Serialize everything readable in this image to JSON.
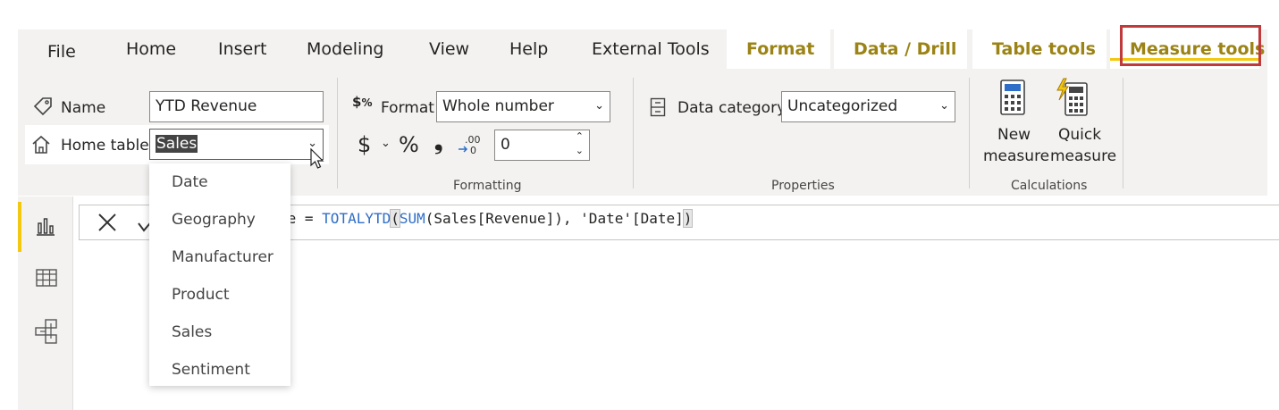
{
  "tabs": {
    "file": "File",
    "home": "Home",
    "insert": "Insert",
    "modeling": "Modeling",
    "view": "View",
    "help": "Help",
    "external_tools": "External Tools",
    "format": "Format",
    "data_drill": "Data / Drill",
    "table_tools": "Table tools",
    "measure_tools": "Measure tools"
  },
  "structure": {
    "name_label": "Name",
    "name_value": "YTD Revenue",
    "home_table_label": "Home table",
    "home_table_value": "Sales"
  },
  "formatting": {
    "format_label": "Format",
    "format_value": "Whole number",
    "currency_symbol": "$",
    "percent_symbol": "%",
    "comma_symbol": "❟",
    "decimal_value": "0",
    "group_label": "Formatting"
  },
  "properties": {
    "data_category_label": "Data category",
    "data_category_value": "Uncategorized",
    "group_label": "Properties"
  },
  "calculations": {
    "new_measure_line1": "New",
    "new_measure_line2": "measure",
    "quick_measure_line1": "Quick",
    "quick_measure_line2": "measure",
    "group_label": "Calculations"
  },
  "formula_bar": {
    "text_prefix": "ue = ",
    "fn_totalytd": "TOTALYTD",
    "open_paren": "(",
    "fn_sum": "SUM",
    "text_middle": "(Sales[Revenue]), 'Date'[Date]",
    "close_paren": ")"
  },
  "home_table_dropdown": {
    "options": [
      "Date",
      "Geography",
      "Manufacturer",
      "Product",
      "Sales",
      "Sentiment"
    ]
  },
  "colors": {
    "accent_yellow": "#f2c811",
    "context_tab_text": "#9b8315",
    "highlight_border": "#c0393b",
    "function_keyword": "#2f6ec8"
  },
  "icons": {
    "name": "tag-icon",
    "home_table": "home-icon",
    "format": "currency-format-icon",
    "data_category": "data-category-icon",
    "new_measure": "calculator-icon",
    "quick_measure": "quick-calculator-icon",
    "report_view": "bar-chart-icon",
    "data_view": "table-grid-icon",
    "model_view": "model-icon",
    "cancel": "close-icon",
    "commit": "check-icon"
  }
}
